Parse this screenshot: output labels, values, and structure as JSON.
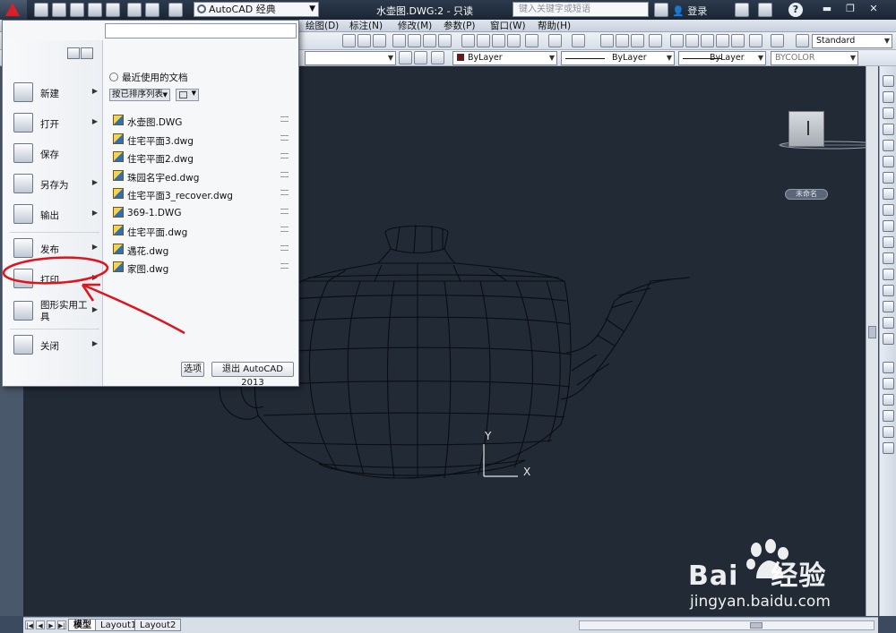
{
  "titlebar": {
    "workspace": "AutoCAD 经典",
    "title": "水壶图.DWG:2 - 只读",
    "search_placeholder": "键入关键字或短语",
    "login": "登录",
    "help": "?"
  },
  "menubar": {
    "items": [
      "绘图(D)",
      "标注(N)",
      "修改(M)",
      "参数(P)",
      "窗口(W)",
      "帮助(H)"
    ]
  },
  "toolbar": {
    "text_style": "Standard",
    "color": "ByLayer",
    "linetype": "ByLayer",
    "lineweight": "ByLayer",
    "plotstyle": "BYCOLOR"
  },
  "app_menu": {
    "search_value": "",
    "items": [
      {
        "label": "新建",
        "icon": "new-icon",
        "has_sub": true
      },
      {
        "label": "打开",
        "icon": "open-icon",
        "has_sub": true
      },
      {
        "label": "保存",
        "icon": "save-icon",
        "has_sub": false
      },
      {
        "label": "另存为",
        "icon": "save-as-icon",
        "has_sub": true
      },
      {
        "label": "输出",
        "icon": "export-icon",
        "has_sub": true
      },
      {
        "label": "发布",
        "icon": "publish-icon",
        "has_sub": true
      },
      {
        "label": "打印",
        "icon": "print-icon",
        "has_sub": true
      },
      {
        "label": "图形实用工\n具",
        "icon": "drawing-utilities-icon",
        "has_sub": true
      },
      {
        "label": "关闭",
        "icon": "close-icon",
        "has_sub": true
      }
    ],
    "recent_title": "最近使用的文档",
    "sort_by": "按已排序列表",
    "recent_docs": [
      "水壶图.DWG",
      "住宅平面3.dwg",
      "住宅平面2.dwg",
      "珠园名宇ed.dwg",
      "住宅平面3_recover.dwg",
      "369-1.DWG",
      "住宅平面.dwg",
      "遇花.dwg",
      "家图.dwg"
    ],
    "options_button": "选项",
    "exit_button": "退出 AutoCAD 2013"
  },
  "viewport": {
    "unnamed_label": "未命名",
    "ucs_x": "X",
    "ucs_y": "Y"
  },
  "layout_tabs": [
    "模型",
    "Layout1",
    "Layout2"
  ],
  "watermark": {
    "brand_text": "Bai",
    "brand_cn": "经验",
    "url": "jingyan.baidu.com"
  },
  "colors": {
    "canvas_bg": "#222a36",
    "annotation_red": "#e0141e",
    "autocad_logo": "#d8202a"
  }
}
